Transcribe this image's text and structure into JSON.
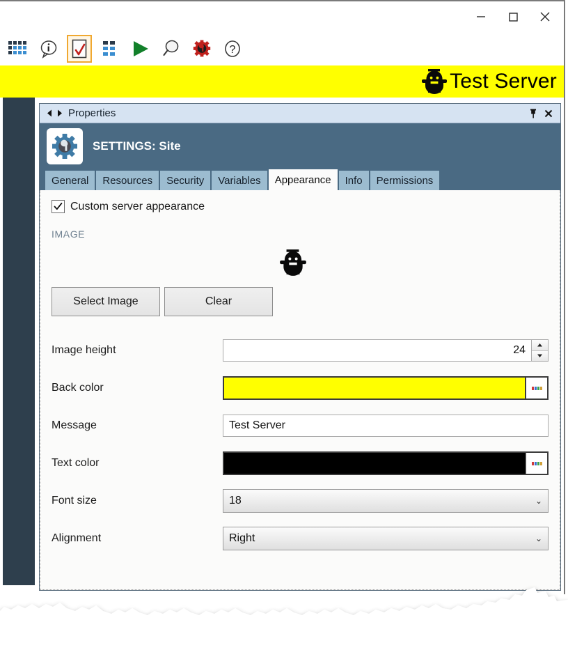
{
  "window": {
    "controls": [
      {
        "name": "minimize",
        "glyph": "minimize-icon"
      },
      {
        "name": "maximize",
        "glyph": "maximize-icon"
      },
      {
        "name": "close",
        "glyph": "close-icon"
      }
    ]
  },
  "toolbar": {
    "items": [
      {
        "name": "grid-icon",
        "selected": false
      },
      {
        "name": "info-bubble-icon",
        "selected": false
      },
      {
        "name": "checklist-icon",
        "selected": true
      },
      {
        "name": "columns-icon",
        "selected": false
      },
      {
        "name": "play-icon",
        "selected": false
      },
      {
        "name": "search-icon",
        "selected": false
      },
      {
        "name": "gear-wrench-icon",
        "selected": false
      },
      {
        "name": "help-icon",
        "selected": false
      }
    ]
  },
  "banner": {
    "message": "Test Server",
    "back_color": "#ffff00",
    "text_color": "#000000",
    "font_size": 18,
    "alignment": "Right",
    "robot_icon": "robot-icon"
  },
  "properties_panel": {
    "title": "Properties",
    "nav_back_icon": "nav-back-icon",
    "nav_forward_icon": "nav-forward-icon",
    "pin_icon": "pin-icon",
    "close_icon": "close-icon",
    "header": {
      "icon": "settings-gear-wrench-icon",
      "title": "SETTINGS: Site"
    },
    "tabs": [
      {
        "label": "General",
        "active": false
      },
      {
        "label": "Resources",
        "active": false
      },
      {
        "label": "Security",
        "active": false
      },
      {
        "label": "Variables",
        "active": false
      },
      {
        "label": "Appearance",
        "active": true
      },
      {
        "label": "Info",
        "active": false
      },
      {
        "label": "Permissions",
        "active": false
      }
    ]
  },
  "appearance": {
    "custom_checkbox": {
      "label": "Custom server appearance",
      "checked": true
    },
    "image_group_label": "IMAGE",
    "preview_icon": "robot-icon",
    "select_image_button": "Select Image",
    "clear_button": "Clear",
    "fields": [
      {
        "label": "Image height",
        "type": "spinner",
        "value": "24"
      },
      {
        "label": "Back color",
        "type": "color",
        "value": "#ffff00"
      },
      {
        "label": "Message",
        "type": "text",
        "value": "Test Server"
      },
      {
        "label": "Text color",
        "type": "color",
        "value": "#000000"
      },
      {
        "label": "Font size",
        "type": "combo",
        "value": "18"
      },
      {
        "label": "Alignment",
        "type": "combo",
        "value": "Right"
      }
    ]
  },
  "colors": {
    "banner_yellow": "#ffff00",
    "panel_header_blue": "#4a6a83",
    "tab_inactive_blue": "#9cbcd0",
    "sidebar_dark": "#2e3f4d",
    "titlebar_light": "#d6e3f2",
    "accent_orange": "#f0a830",
    "play_green": "#12802a"
  }
}
